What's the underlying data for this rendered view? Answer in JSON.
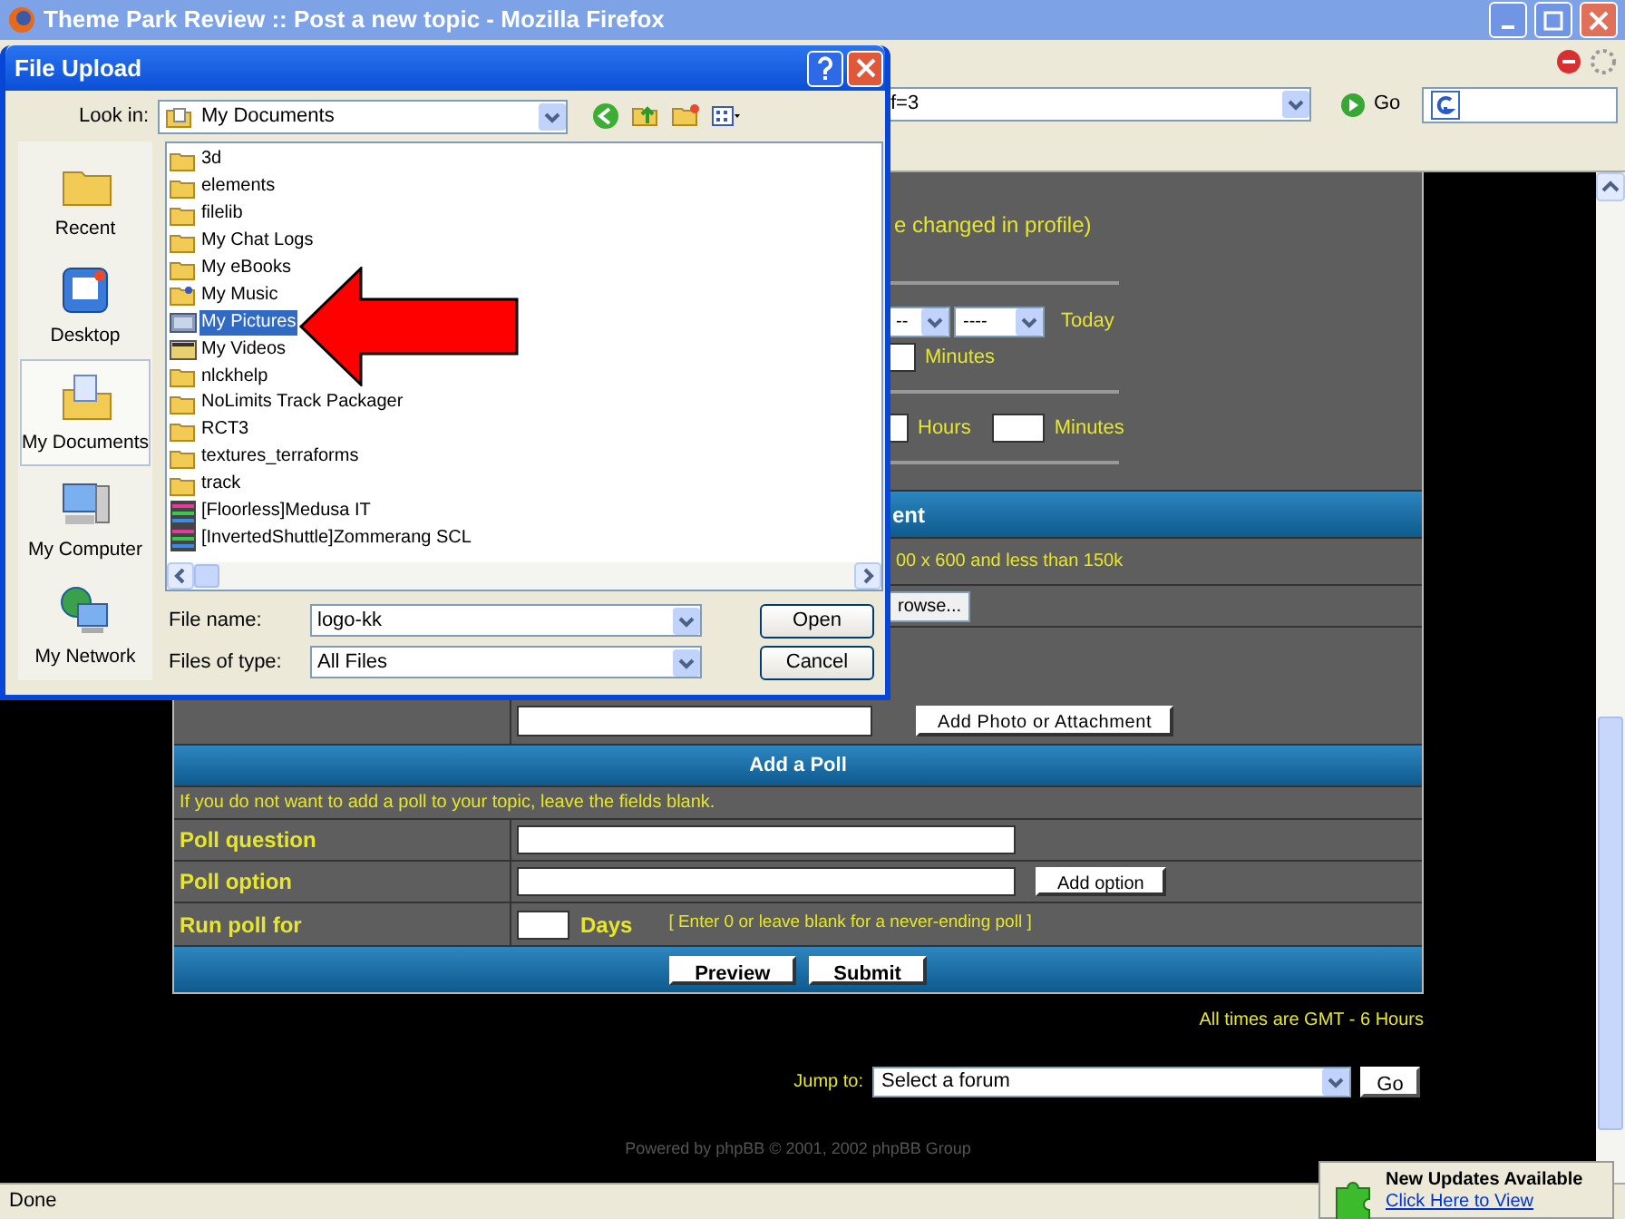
{
  "window": {
    "title": "Theme Park Review :: Post a new topic - Mozilla Firefox"
  },
  "address_bar": {
    "value": "f=3",
    "go": "Go"
  },
  "dialog": {
    "title": "File Upload",
    "look_in_label": "Look in:",
    "look_in": "My Documents",
    "places": [
      {
        "label": "Recent",
        "kind": "recent",
        "selected": false
      },
      {
        "label": "Desktop",
        "kind": "desktop",
        "selected": false
      },
      {
        "label": "My Documents",
        "kind": "documents",
        "selected": true
      },
      {
        "label": "My Computer",
        "kind": "computer",
        "selected": false
      },
      {
        "label": "My Network",
        "kind": "network",
        "selected": false
      }
    ],
    "files": [
      {
        "name": "3d",
        "kind": "folder",
        "selected": false
      },
      {
        "name": "elements",
        "kind": "folder",
        "selected": false
      },
      {
        "name": "filelib",
        "kind": "folder",
        "selected": false
      },
      {
        "name": "My Chat Logs",
        "kind": "folder",
        "selected": false
      },
      {
        "name": "My eBooks",
        "kind": "folder",
        "selected": false
      },
      {
        "name": "My Music",
        "kind": "music",
        "selected": false
      },
      {
        "name": "My Pictures",
        "kind": "pictures",
        "selected": true
      },
      {
        "name": "My Videos",
        "kind": "videos",
        "selected": false
      },
      {
        "name": "nlckhelp",
        "kind": "folder",
        "selected": false
      },
      {
        "name": "NoLimits Track Packager",
        "kind": "folder",
        "selected": false
      },
      {
        "name": "RCT3",
        "kind": "folder",
        "selected": false
      },
      {
        "name": "textures_terraforms",
        "kind": "folder",
        "selected": false
      },
      {
        "name": "track",
        "kind": "folder",
        "selected": false
      },
      {
        "name": "[Floorless]Medusa IT",
        "kind": "archive",
        "selected": false
      },
      {
        "name": "[InvertedShuttle]Zommerang SCL",
        "kind": "archive",
        "selected": false
      }
    ],
    "file_name_label": "File name:",
    "file_name": "logo-kk",
    "file_type_label": "Files of type:",
    "file_type": "All Files",
    "buttons": [
      "Open",
      "Cancel"
    ]
  },
  "form": {
    "profile_note": "e changed in profile)",
    "date_selects": [
      "--",
      "----"
    ],
    "today": "Today",
    "minutes_1": "Minutes",
    "hours": "Hours",
    "minutes_2": "Minutes",
    "attachment_header": "ent",
    "attachment_note": "00 x 600 and less than 150k",
    "browse": "rowse...",
    "add_attachment": "Add Photo or Attachment",
    "poll": {
      "header": "Add a Poll",
      "note": "If you do not want to add a poll to your topic, leave the fields blank.",
      "question_label": "Poll question",
      "option_label": "Poll option",
      "add_option": "Add option",
      "run_label": "Run poll for",
      "days": "Days",
      "run_note": "[ Enter 0 or leave blank for a never-ending poll ]"
    },
    "buttons": [
      "Preview",
      "Submit"
    ]
  },
  "footer": {
    "timezone": "All times are GMT - 6 Hours",
    "jump_label": "Jump to:",
    "jump_select": "Select a forum",
    "go": "Go",
    "powered": "Powered by phpBB © 2001, 2002 phpBB Group"
  },
  "status_bar": {
    "text": "Done"
  },
  "notification": {
    "title": "New Updates Available",
    "link": "Click Here to View"
  }
}
